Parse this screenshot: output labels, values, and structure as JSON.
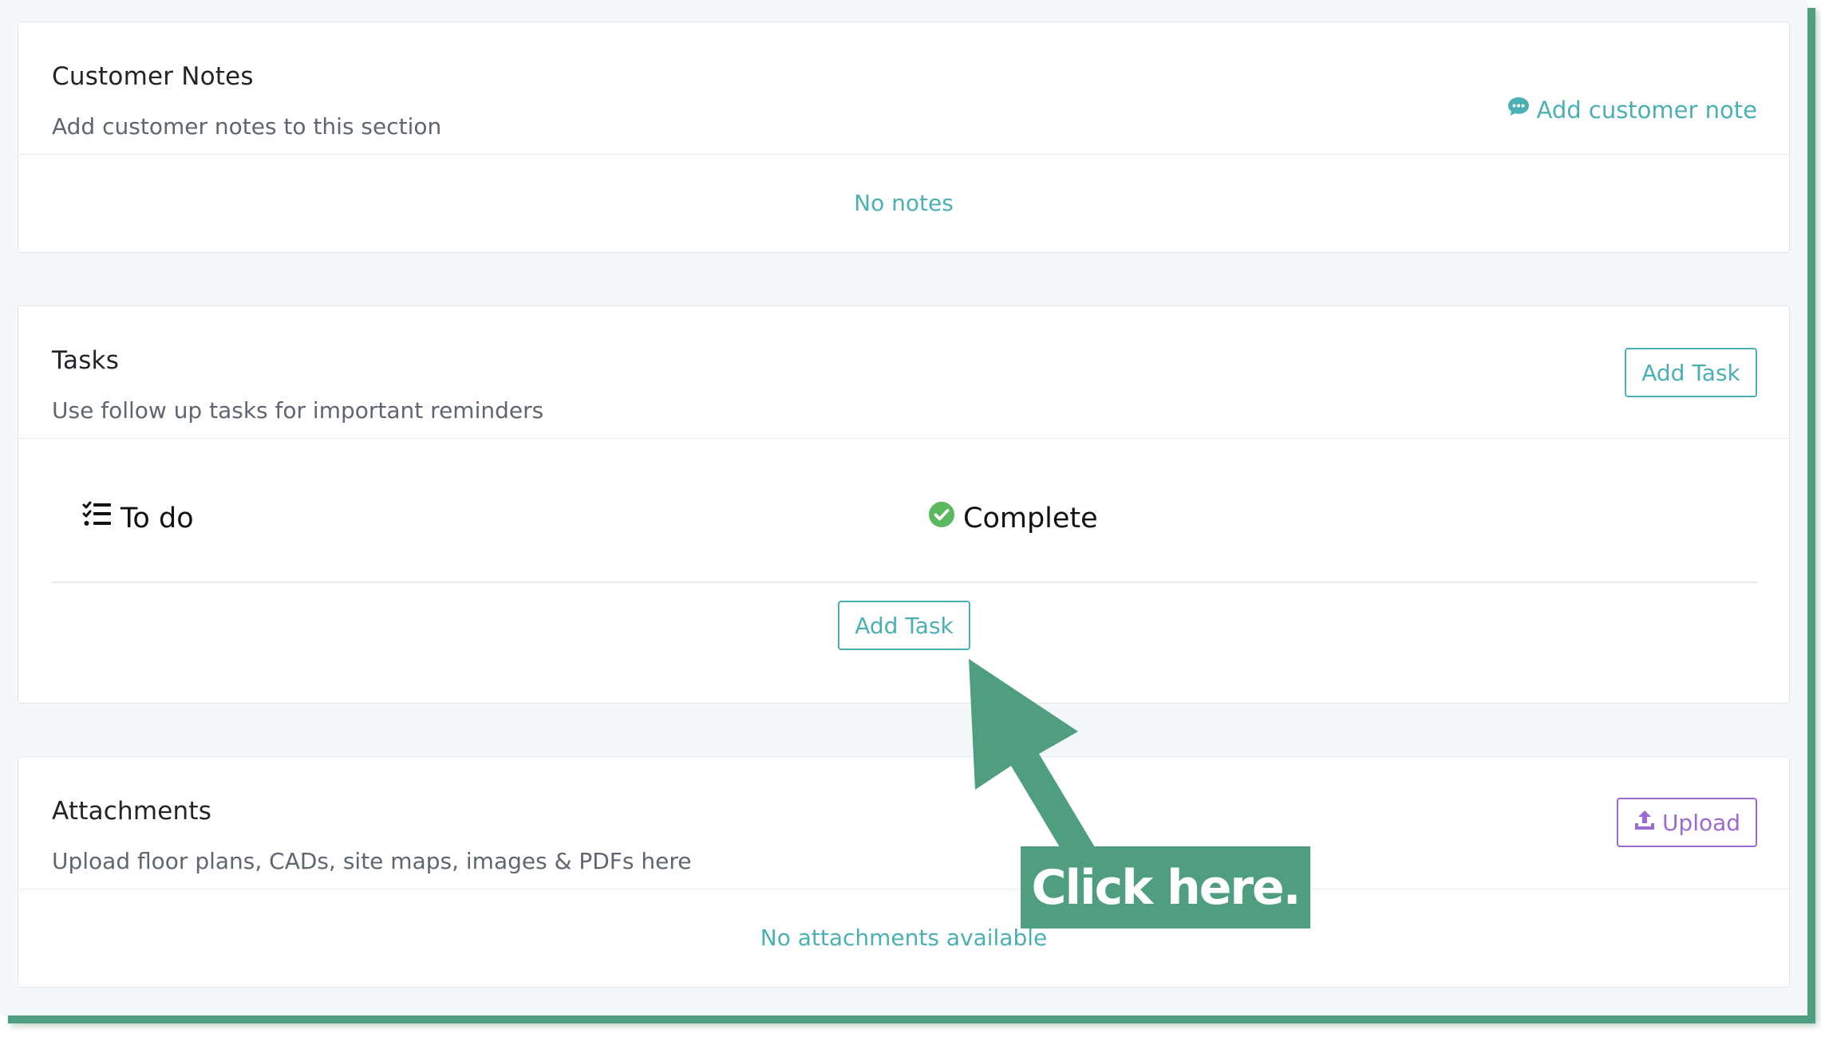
{
  "customer_notes": {
    "title": "Customer Notes",
    "subtitle": "Add customer notes to this section",
    "add_label": "Add customer note",
    "empty_text": "No notes"
  },
  "tasks": {
    "title": "Tasks",
    "subtitle": "Use follow up tasks for important reminders",
    "add_button_label": "Add Task",
    "todo_label": "To do",
    "complete_label": "Complete",
    "inline_add_button_label": "Add Task"
  },
  "attachments": {
    "title": "Attachments",
    "subtitle": "Upload floor plans, CADs, site maps, images & PDFs here",
    "upload_label": "Upload",
    "empty_text": "No attachments available"
  },
  "annotation": {
    "callout_text": "Click here."
  },
  "colors": {
    "accent_teal": "#4bb0b4",
    "accent_purple": "#9b6ad3",
    "annotation_green": "#4f9e80",
    "complete_green": "#5cb85c"
  },
  "icons": {
    "add_note": "comment-dots-icon",
    "todo": "tasks-list-icon",
    "complete": "check-circle-icon",
    "upload": "upload-icon",
    "annotation": "arrow-pointer-icon"
  }
}
